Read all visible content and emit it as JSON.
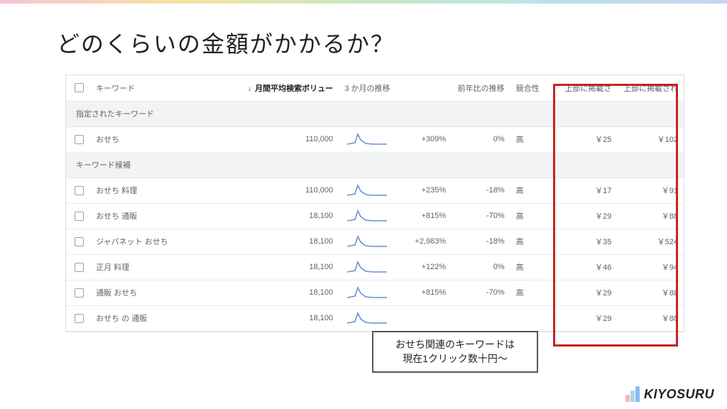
{
  "title": "どのくらいの金額がかかるか？",
  "columns": {
    "keyword": "キーワード",
    "volume": "月間平均検索ボリュー",
    "trend3m": "3 か月の推移",
    "yoy": "前年比の推移",
    "competition": "競合性",
    "bid_low": "上部に掲載さ",
    "bid_high": "上部に掲載され"
  },
  "sections": {
    "provided": "指定されたキーワード",
    "ideas": "キーワード候補"
  },
  "rows": {
    "provided": [
      {
        "kw": "おせち",
        "vol": "110,000",
        "m3": "+309%",
        "yoy": "0%",
        "comp": "高",
        "low": "￥25",
        "high": "￥102"
      }
    ],
    "ideas": [
      {
        "kw": "おせち 料理",
        "vol": "110,000",
        "m3": "+235%",
        "yoy": "-18%",
        "comp": "高",
        "low": "￥17",
        "high": "￥91"
      },
      {
        "kw": "おせち 通販",
        "vol": "18,100",
        "m3": "+815%",
        "yoy": "-70%",
        "comp": "高",
        "low": "￥29",
        "high": "￥88"
      },
      {
        "kw": "ジャパネット おせち",
        "vol": "18,100",
        "m3": "+2,983%",
        "yoy": "-18%",
        "comp": "高",
        "low": "￥35",
        "high": "￥524"
      },
      {
        "kw": "正月 料理",
        "vol": "18,100",
        "m3": "+122%",
        "yoy": "0%",
        "comp": "高",
        "low": "￥46",
        "high": "￥94"
      },
      {
        "kw": "通販 おせち",
        "vol": "18,100",
        "m3": "+815%",
        "yoy": "-70%",
        "comp": "高",
        "low": "￥29",
        "high": "￥88"
      },
      {
        "kw": "おせち の 通販",
        "vol": "18,100",
        "m3": "",
        "yoy": "",
        "comp": "",
        "low": "￥29",
        "high": "￥88"
      }
    ]
  },
  "callout": {
    "line1": "おせち関連のキーワードは",
    "line2": "現在1クリック数十円〜"
  },
  "brand": "KIYOSURU"
}
